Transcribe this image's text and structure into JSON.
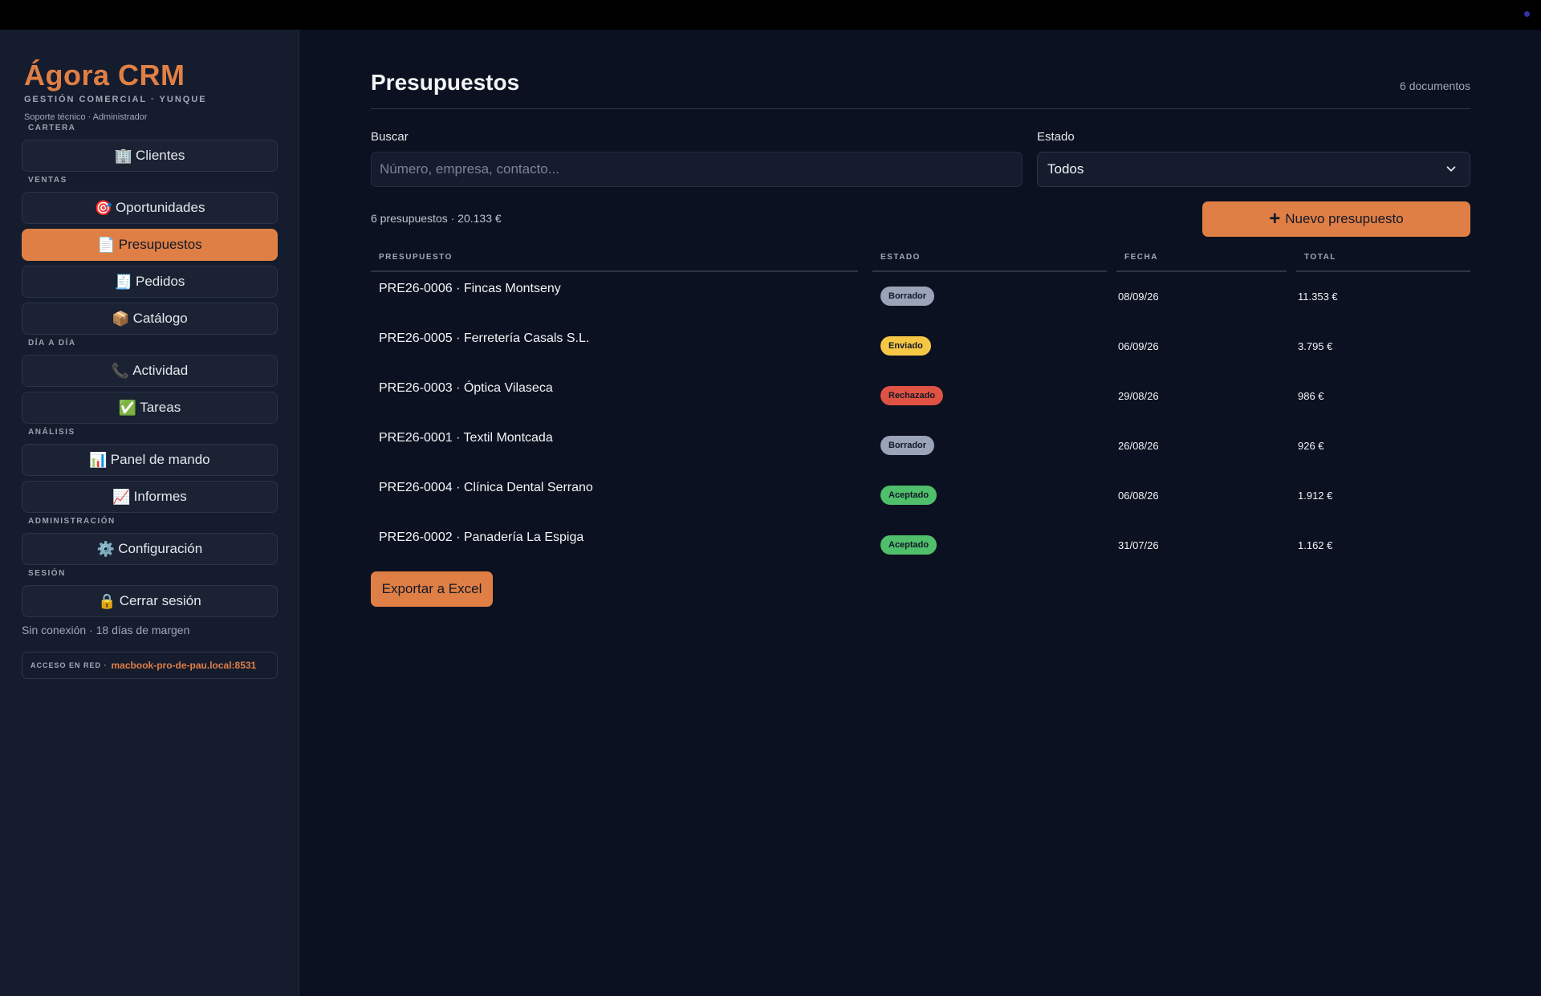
{
  "brand": {
    "name": "Ágora CRM",
    "subtitle": "GESTIÓN COMERCIAL · YUNQUE",
    "user": "Soporte técnico · Administrador"
  },
  "sidebar": {
    "sections": [
      {
        "label": "CARTERA"
      },
      {
        "label": "VENTAS"
      },
      {
        "label": "DÍA A DÍA"
      },
      {
        "label": "ANÁLISIS"
      },
      {
        "label": "ADMINISTRACIÓN"
      },
      {
        "label": "SESIÓN"
      }
    ],
    "items": [
      {
        "icon": "🏢",
        "label": "Clientes"
      },
      {
        "icon": "🎯",
        "label": "Oportunidades"
      },
      {
        "icon": "📄",
        "label": "Presupuestos",
        "active": true
      },
      {
        "icon": "🧾",
        "label": "Pedidos"
      },
      {
        "icon": "📦",
        "label": "Catálogo"
      },
      {
        "icon": "📞",
        "label": "Actividad"
      },
      {
        "icon": "✅",
        "label": "Tareas"
      },
      {
        "icon": "📊",
        "label": "Panel de mando"
      },
      {
        "icon": "📈",
        "label": "Informes"
      },
      {
        "icon": "⚙️",
        "label": "Configuración"
      },
      {
        "icon": "🔒",
        "label": "Cerrar sesión"
      }
    ],
    "offline": "Sin conexión · 18 días de margen",
    "network_label": "ACCESO EN RED ·",
    "network_host": "macbook-pro-de-pau.local:8531"
  },
  "main": {
    "title": "Presupuestos",
    "doc_count": "6 documentos",
    "search_label": "Buscar",
    "search_placeholder": "Número, empresa, contacto...",
    "status_label": "Estado",
    "status_value": "Todos",
    "summary": "6 presupuestos · 20.133 €",
    "new_button": "Nuevo presupuesto",
    "export_button": "Exportar a Excel",
    "columns": [
      "PRESUPUESTO",
      "ESTADO",
      "FECHA",
      "TOTAL"
    ],
    "rows": [
      {
        "name": "PRE26-0006 · Fincas Montseny",
        "status": "Borrador",
        "status_kind": "borrador",
        "date": "08/09/26",
        "total": "11.353 €"
      },
      {
        "name": "PRE26-0005 · Ferretería Casals S.L.",
        "status": "Enviado",
        "status_kind": "enviado",
        "date": "06/09/26",
        "total": "3.795 €"
      },
      {
        "name": "PRE26-0003 · Óptica Vilaseca",
        "status": "Rechazado",
        "status_kind": "rechazado",
        "date": "29/08/26",
        "total": "986 €"
      },
      {
        "name": "PRE26-0001 · Textil Montcada",
        "status": "Borrador",
        "status_kind": "borrador",
        "date": "26/08/26",
        "total": "926 €"
      },
      {
        "name": "PRE26-0004 · Clínica Dental Serrano",
        "status": "Aceptado",
        "status_kind": "aceptado",
        "date": "06/08/26",
        "total": "1.912 €"
      },
      {
        "name": "PRE26-0002 · Panadería La Espiga",
        "status": "Aceptado",
        "status_kind": "aceptado",
        "date": "31/07/26",
        "total": "1.162 €"
      }
    ]
  },
  "colors": {
    "accent": "#e07f45",
    "background": "#0b1120",
    "sidebar": "#151c2e"
  }
}
